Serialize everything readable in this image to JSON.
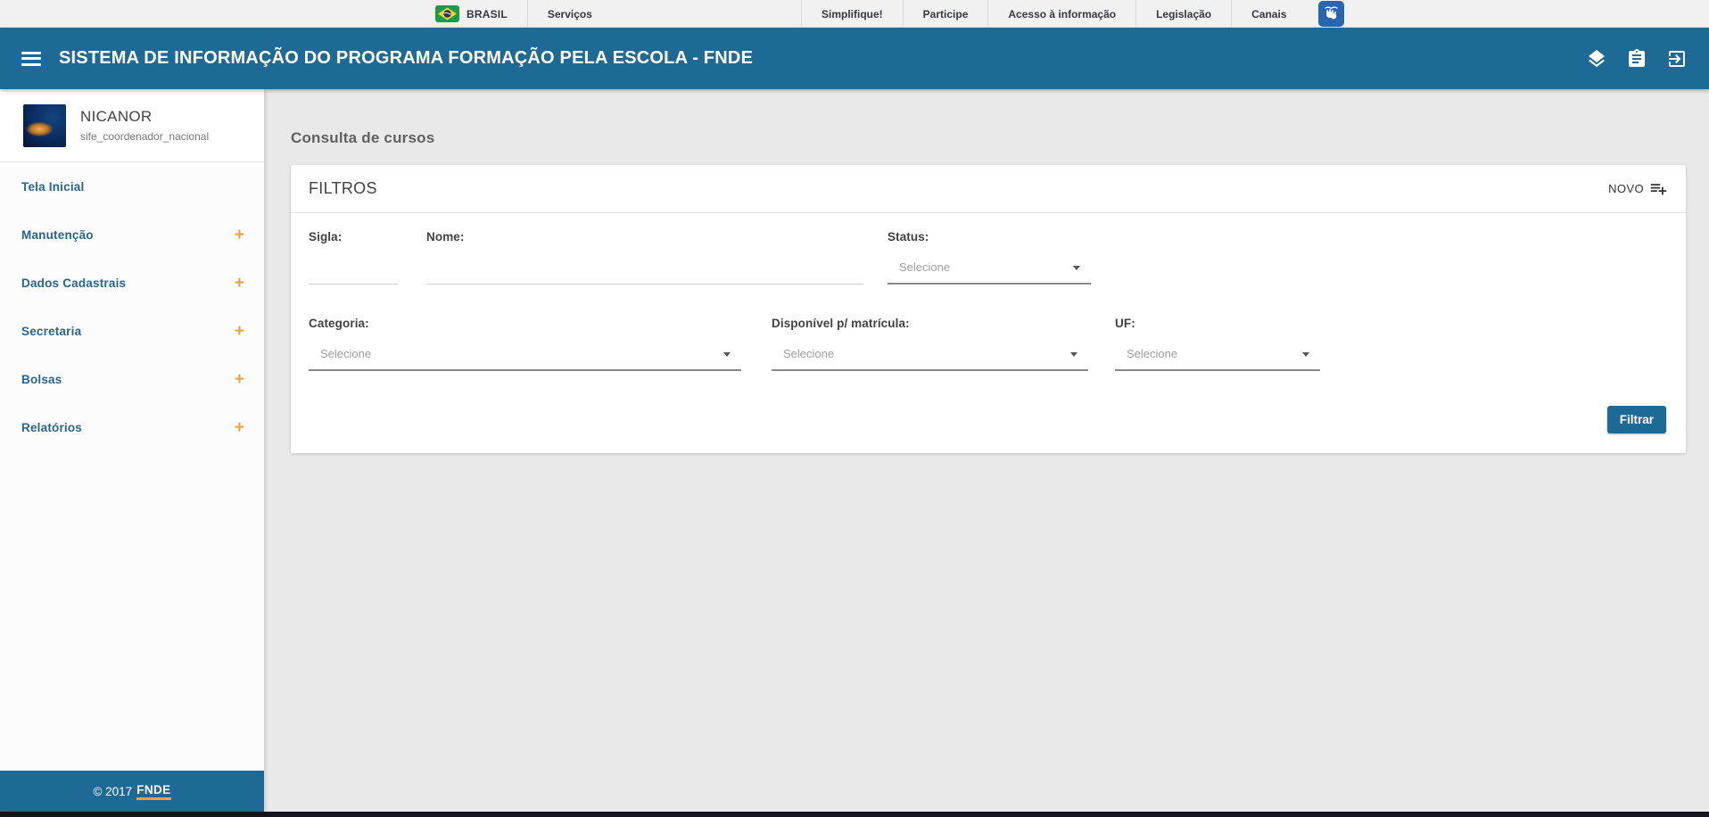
{
  "gov_bar": {
    "brand": "BRASIL",
    "services_label": "Serviços",
    "links": [
      "Simplifique!",
      "Participe",
      "Acesso à informação",
      "Legislação",
      "Canais"
    ]
  },
  "header": {
    "title": "SISTEMA DE INFORMAÇÃO DO PROGRAMA FORMAÇÃO PELA ESCOLA - FNDE"
  },
  "sidebar": {
    "user": {
      "name": "NICANOR",
      "role": "sife_coordenador_nacional"
    },
    "expand_glyph": "+",
    "items": [
      {
        "label": "Tela Inicial"
      },
      {
        "label": "Manutenção"
      },
      {
        "label": "Dados Cadastrais"
      },
      {
        "label": "Secretaria"
      },
      {
        "label": "Bolsas"
      },
      {
        "label": "Relatórios"
      }
    ],
    "footer": {
      "copyright": "© 2017",
      "brand": "FNDE"
    }
  },
  "main": {
    "page_title": "Consulta de cursos",
    "filters": {
      "title": "FILTROS",
      "new_button_label": "NOVO",
      "sigla_label": "Sigla:",
      "sigla_value": "",
      "nome_label": "Nome:",
      "nome_value": "",
      "status_label": "Status:",
      "status_placeholder": "Selecione",
      "categoria_label": "Categoria:",
      "categoria_placeholder": "Selecione",
      "disponivel_label": "Disponível p/ matrícula:",
      "disponivel_placeholder": "Selecione",
      "uf_label": "UF:",
      "uf_placeholder": "Selecione",
      "submit_label": "Filtrar"
    }
  },
  "colors": {
    "primary_blue": "#1e6a96",
    "accent_orange": "#f0a03c",
    "menu_link_blue": "#2a6491",
    "page_background": "#e9e9e9"
  }
}
